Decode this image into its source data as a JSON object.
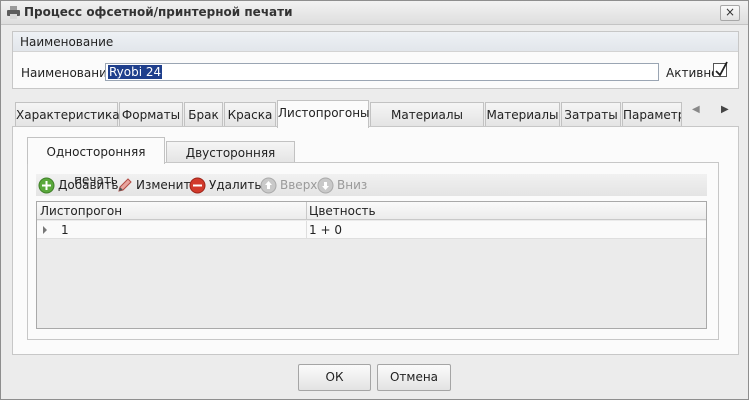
{
  "window": {
    "title": "Процесс офсетной/принтерной печати",
    "close_glyph": "×"
  },
  "name_group": {
    "header": "Наименование",
    "label": "Наименование:",
    "value": "Ryobi 24",
    "active_label": "Активно",
    "active_checked": true
  },
  "tabs": [
    "Характеристика",
    "Форматы",
    "Брак",
    "Краска",
    "Листопрогоны",
    "Материалы печати",
    "Материалы",
    "Затраты",
    "Параметр"
  ],
  "active_tab": "Листопрогоны",
  "subtabs": [
    "Односторонняя печать",
    "Двусторонняя печать"
  ],
  "active_subtab": "Односторонняя печать",
  "toolbar": {
    "add": "Добавить",
    "edit": "Изменить",
    "delete": "Удалить",
    "up": "Вверх",
    "down": "Вниз"
  },
  "grid": {
    "columns": [
      "Листопрогон",
      "Цветность"
    ],
    "rows": [
      [
        "1",
        "1 + 0"
      ]
    ]
  },
  "buttons": {
    "ok": "ОК",
    "cancel": "Отмена"
  },
  "colors": {
    "selection": "#1f3f8c",
    "add_icon": "#5aa83c",
    "delete_icon": "#d23a2c"
  }
}
